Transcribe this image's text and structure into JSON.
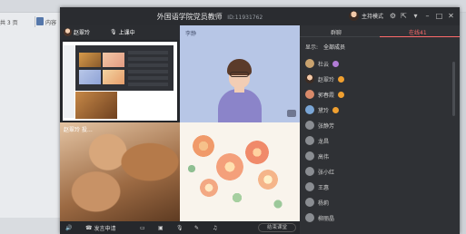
{
  "background_app": {
    "left_text": "共 3 页",
    "doc_label": "内容"
  },
  "window": {
    "title": "外国语学院党员教师",
    "meeting_id": "ID:11931762",
    "host_mode_label": "主持模式"
  },
  "tiles": [
    {
      "name": "赵翠玲",
      "mic_state": "上课中"
    },
    {
      "name": "李静"
    },
    {
      "name": "赵翠玲 投…"
    },
    {
      "name": ""
    }
  ],
  "toolbar": {
    "hand_label": "发言申请",
    "end_label": "结束课堂"
  },
  "panel": {
    "tabs": [
      "群聊",
      "在线41"
    ],
    "show_label": "显示:",
    "show_value": "全部成员",
    "members": [
      {
        "name": "杜云",
        "badge_color": "#b27cd6"
      },
      {
        "name": "赵翠玲",
        "badge_color": "#f0a030"
      },
      {
        "name": "郭春霞",
        "badge_color": "#f0a030"
      },
      {
        "name": "黛玲",
        "badge_color": "#f0a030"
      },
      {
        "name": "张静芳",
        "badge_color": ""
      },
      {
        "name": "龙昌",
        "badge_color": ""
      },
      {
        "name": "高伟",
        "badge_color": ""
      },
      {
        "name": "张小红",
        "badge_color": ""
      },
      {
        "name": "王惠",
        "badge_color": ""
      },
      {
        "name": "杨莉",
        "badge_color": ""
      },
      {
        "name": "柳丽晶",
        "badge_color": ""
      }
    ]
  },
  "colors": {
    "accent": "#ff6b6b",
    "window_bg": "#2a2c30",
    "panel_bg": "#2f3135"
  }
}
